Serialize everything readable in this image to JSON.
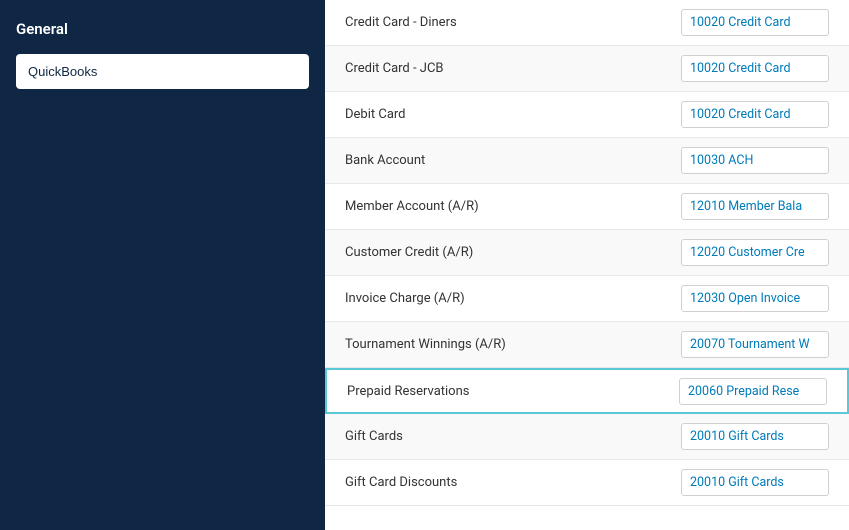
{
  "sidebar": {
    "title": "General",
    "input_value": "QuickBooks"
  },
  "rows": [
    {
      "label": "Credit Card - Diners",
      "value": "10020 Credit Card",
      "highlighted": false
    },
    {
      "label": "Credit Card - JCB",
      "value": "10020 Credit Card",
      "highlighted": false
    },
    {
      "label": "Debit Card",
      "value": "10020 Credit Card",
      "highlighted": false
    },
    {
      "label": "Bank Account",
      "value": "10030 ACH",
      "highlighted": false
    },
    {
      "label": "Member Account (A/R)",
      "value": "12010 Member Bala",
      "highlighted": false
    },
    {
      "label": "Customer Credit (A/R)",
      "value": "12020 Customer Cre",
      "highlighted": false
    },
    {
      "label": "Invoice Charge (A/R)",
      "value": "12030 Open Invoice",
      "highlighted": false
    },
    {
      "label": "Tournament Winnings (A/R)",
      "value": "20070 Tournament W",
      "highlighted": false
    },
    {
      "label": "Prepaid Reservations",
      "value": "20060 Prepaid Rese",
      "highlighted": true
    },
    {
      "label": "Gift Cards",
      "value": "20010 Gift Cards",
      "highlighted": false
    },
    {
      "label": "Gift Card Discounts",
      "value": "20010 Gift Cards",
      "highlighted": false
    }
  ]
}
